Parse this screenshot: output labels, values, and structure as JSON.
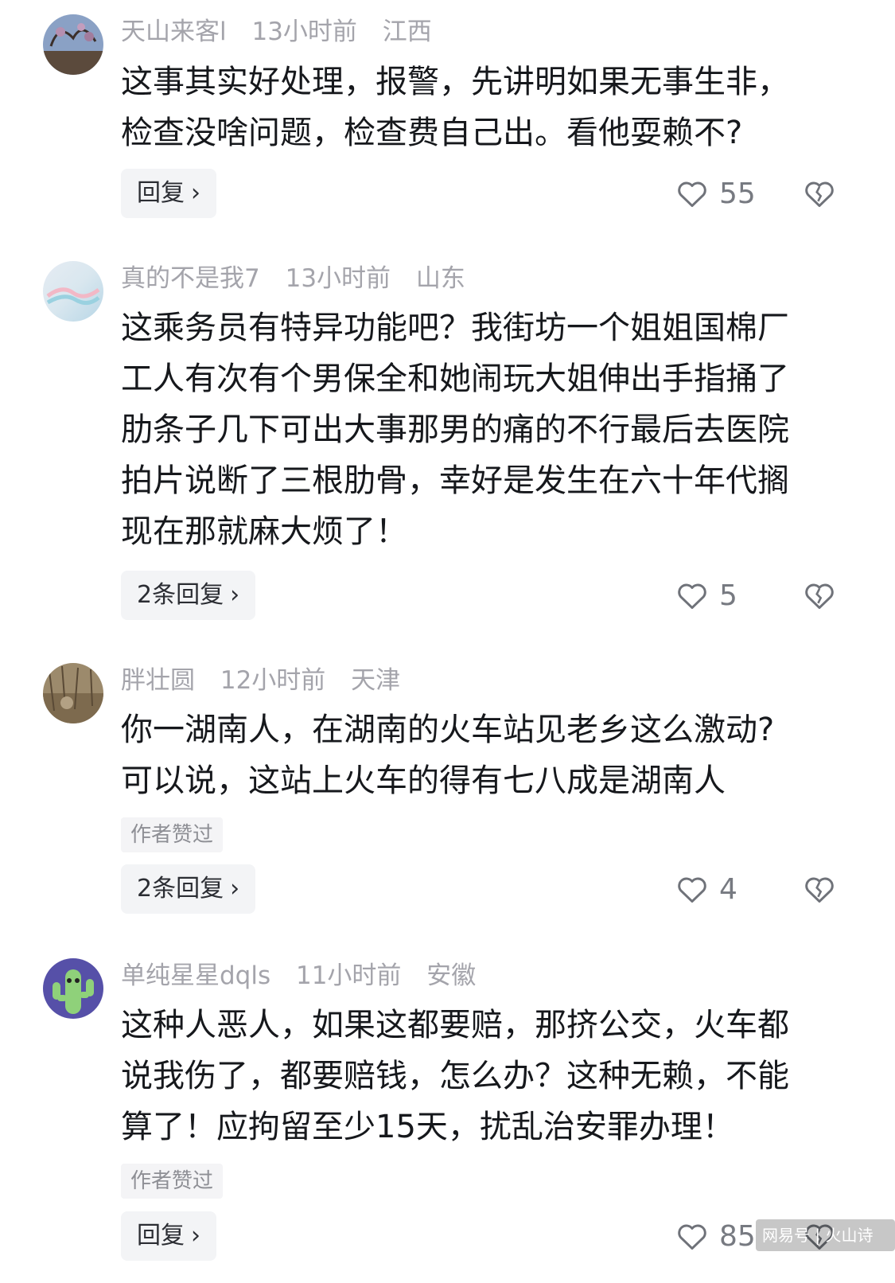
{
  "comments": [
    {
      "username": "天山来客l",
      "time": "13小时前",
      "location": "江西",
      "text_lines": [
        "这事其实好处理，报警，先讲明如果无事生非，",
        "检查没啥问题，检查费自己出。看他耍赖不?"
      ],
      "author_liked_label": "",
      "reply_label": "回复",
      "like_count": "55",
      "avatar": "tree-photo-avatar"
    },
    {
      "username": "真的不是我7",
      "time": "13小时前",
      "location": "山东",
      "text_lines": [
        "这乘务员有特异功能吧？我街坊一个姐姐国棉厂",
        "工人有次有个男保全和她闹玩大姐伸出手指捅了",
        "肋条子几下可出大事那男的痛的不行最后去医院",
        "拍片说断了三根肋骨，幸好是发生在六十年代搁",
        "现在那就麻大烦了！"
      ],
      "author_liked_label": "",
      "reply_label": "2条回复",
      "like_count": "5",
      "avatar": "cloud-gradient-avatar"
    },
    {
      "username": "胖壮圆",
      "time": "12小时前",
      "location": "天津",
      "text_lines": [
        "你一湖南人，在湖南的火车站见老乡这么激动?",
        "可以说，这站上火车的得有七八成是湖南人"
      ],
      "author_liked_label": "作者赞过",
      "reply_label": "2条回复",
      "like_count": "4",
      "avatar": "field-photo-avatar"
    },
    {
      "username": "单纯星星dqls",
      "time": "11小时前",
      "location": "安徽",
      "text_lines": [
        "这种人恶人，如果这都要赔，那挤公交，火车都",
        "说我伤了，都要赔钱，怎么办？这种无赖，不能",
        "算了！应拘留至少15天，扰乱治安罪办理！"
      ],
      "author_liked_label": "作者赞过",
      "reply_label": "回复",
      "like_count": "85",
      "avatar": "cactus-cartoon-avatar"
    }
  ],
  "icons": {
    "like": "heart-outline-icon",
    "dislike": "broken-heart-icon",
    "chevron": "chevron-right-icon"
  },
  "watermark": "网易号 | 火山诗话",
  "colors": {
    "meta_gray": "#a4a4ab",
    "text": "#16181c",
    "button_bg": "#f3f4f6"
  }
}
